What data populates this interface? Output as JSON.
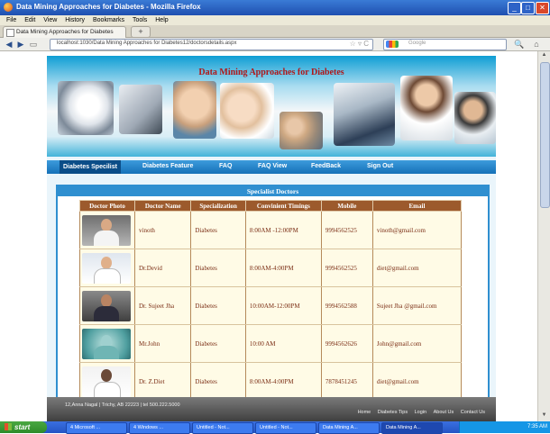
{
  "window": {
    "title": "Data Mining Approaches for Diabetes - Mozilla Firefox"
  },
  "menu": [
    "File",
    "Edit",
    "View",
    "History",
    "Bookmarks",
    "Tools",
    "Help"
  ],
  "tab": {
    "label": "Data Mining Approaches for Diabetes",
    "new_tab": "+"
  },
  "nav": {
    "url": "localhost:1030/Data Mining Approaches for Diabetes12/doctorsdetails.aspx",
    "search_placeholder": "Google",
    "back": "◀",
    "forward": "▶"
  },
  "site": {
    "banner_title": "Data Mining Approaches for Diabetes",
    "menu": [
      "Diabetes Specilist",
      "Diabetes Feature",
      "FAQ",
      "FAQ View",
      "FeedBack",
      "Sign Out"
    ],
    "panel_title": "Specialist Doctors",
    "table_headers": [
      "Doctor Photo",
      "Doctor Name",
      "Specialization",
      "Convinient Timings",
      "Mobile",
      "Email"
    ],
    "doctors": [
      {
        "name": "vinoth",
        "specialization": "Diabetes",
        "timings": "8:00AM -12:00PM",
        "mobile": "9994562525",
        "email": "vinoth@gmail.com"
      },
      {
        "name": "Dr.Devid",
        "specialization": "Diabetes",
        "timings": "8:00AM-4:00PM",
        "mobile": "9994562525",
        "email": "diet@gmail.com"
      },
      {
        "name": "Dr. Sujeet Jha",
        "specialization": "Diabetes",
        "timings": "10:00AM-12:00PM",
        "mobile": "9994562588",
        "email": "Sujeet Jha @gmail.com"
      },
      {
        "name": "Mr.John",
        "specialization": "Diabetes",
        "timings": "10:00 AM",
        "mobile": "9994562626",
        "email": "John@gmail.com"
      },
      {
        "name": "Dr. Z.Diet",
        "specialization": "Diabetes",
        "timings": "8:00AM-4:00PM",
        "mobile": "7878451245",
        "email": "diet@gmail.com"
      }
    ],
    "footer_address": "12,Anna Nagal | Trichy, AB 22223 | tel 500.222.5000",
    "footer_links": [
      "Home",
      "Diabetes Tips",
      "Login",
      "About Us",
      "Contact Us"
    ]
  },
  "taskbar": {
    "start": "start",
    "items": [
      "4 Microsoft ...",
      "4 Windows ...",
      "Untitled - Not...",
      "Untitled - Not...",
      "Data Mining A...",
      "Data Mining A..."
    ],
    "clock": "7:35 AM"
  }
}
